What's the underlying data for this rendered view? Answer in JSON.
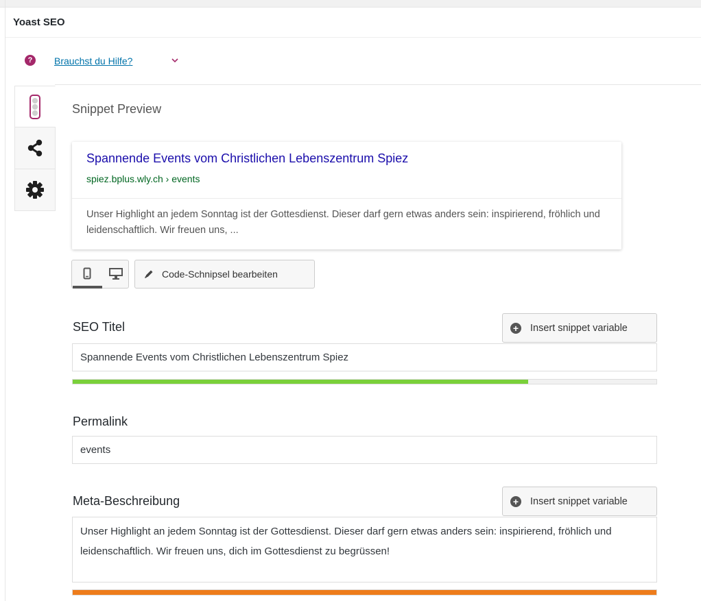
{
  "header": {
    "title": "Yoast SEO"
  },
  "help": {
    "link_label": "Brauchst du Hilfe?",
    "icon": "question-circle-icon"
  },
  "side_tabs": [
    {
      "name": "seo-analysis",
      "icon": "traffic-light-icon",
      "active": true
    },
    {
      "name": "social",
      "icon": "share-icon",
      "active": false
    },
    {
      "name": "advanced",
      "icon": "gear-icon",
      "active": false
    }
  ],
  "snippet": {
    "heading": "Snippet Preview",
    "title": "Spannende Events vom Christlichen Lebenszentrum Spiez",
    "url": "spiez.bplus.wly.ch › events",
    "description": "Unser Highlight an jedem Sonntag ist der Gottesdienst. Dieser darf gern etwas anders sein: inspirierend, fröhlich und leidenschaftlich. Wir freuen uns, ...",
    "edit_label": "Code-Schnipsel bearbeiten",
    "devices": [
      {
        "name": "mobile",
        "icon": "mobile-icon",
        "active": true
      },
      {
        "name": "desktop",
        "icon": "desktop-icon",
        "active": false
      }
    ]
  },
  "seo_title": {
    "label": "SEO Titel",
    "insert_label": "Insert snippet variable",
    "value": "Spannende Events vom Christlichen Lebenszentrum Spiez",
    "progress": 0.78,
    "progress_color": "#7ad03a"
  },
  "permalink": {
    "label": "Permalink",
    "value": "events"
  },
  "meta_description": {
    "label": "Meta-Beschreibung",
    "insert_label": "Insert snippet variable",
    "value": "Unser Highlight an jedem Sonntag ist der Gottesdienst. Dieser darf gern etwas anders sein: inspirierend, fröhlich und leidenschaftlich. Wir freuen uns, dich im Gottesdienst zu begrüssen!",
    "progress": 1.0,
    "progress_color": "#ee7c1b"
  },
  "colors": {
    "accent": "#a4286a",
    "link": "#0073aa",
    "serp_title": "#1a0dab",
    "serp_url": "#006621"
  }
}
